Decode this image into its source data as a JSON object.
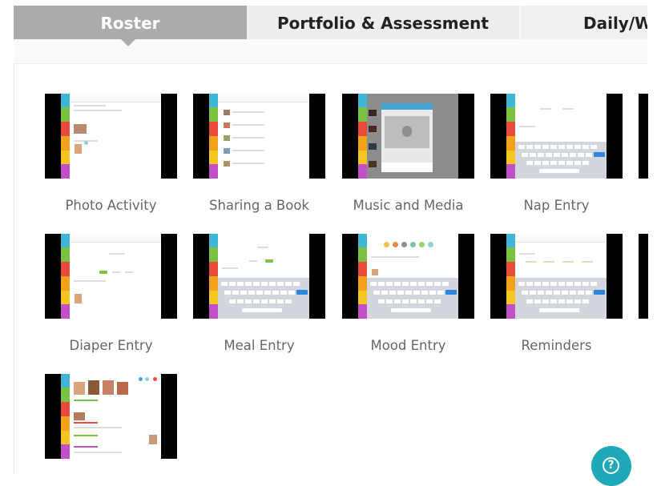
{
  "tabs": [
    {
      "label": "Roster",
      "active": true
    },
    {
      "label": "Portfolio & Assessment",
      "active": false
    },
    {
      "label": "Daily/We",
      "active": false
    }
  ],
  "tiles": [
    {
      "label": "Photo Activity",
      "thumb_icon": "photo-activity-screenshot"
    },
    {
      "label": "Sharing a Book",
      "thumb_icon": "sharing-book-screenshot"
    },
    {
      "label": "Music and Media",
      "thumb_icon": "music-media-screenshot"
    },
    {
      "label": "Nap Entry",
      "thumb_icon": "nap-entry-screenshot"
    },
    {
      "label": "Diaper Entry",
      "thumb_icon": "diaper-entry-screenshot"
    },
    {
      "label": "Meal Entry",
      "thumb_icon": "meal-entry-screenshot"
    },
    {
      "label": "Mood Entry",
      "thumb_icon": "mood-entry-screenshot"
    },
    {
      "label": "Reminders",
      "thumb_icon": "reminders-screenshot"
    },
    {
      "label": "",
      "thumb_icon": "activity-feed-screenshot"
    }
  ],
  "help": {
    "glyph": "?",
    "icon": "help-icon"
  },
  "colors": {
    "tab_active": "#ababab",
    "tab_inactive": "#ededed",
    "help_button": "#1fa9b8",
    "sidebar": [
      "#3fb6d6",
      "#7cc242",
      "#e84b3c",
      "#f2a11d",
      "#f4c623",
      "#c450c8"
    ]
  }
}
